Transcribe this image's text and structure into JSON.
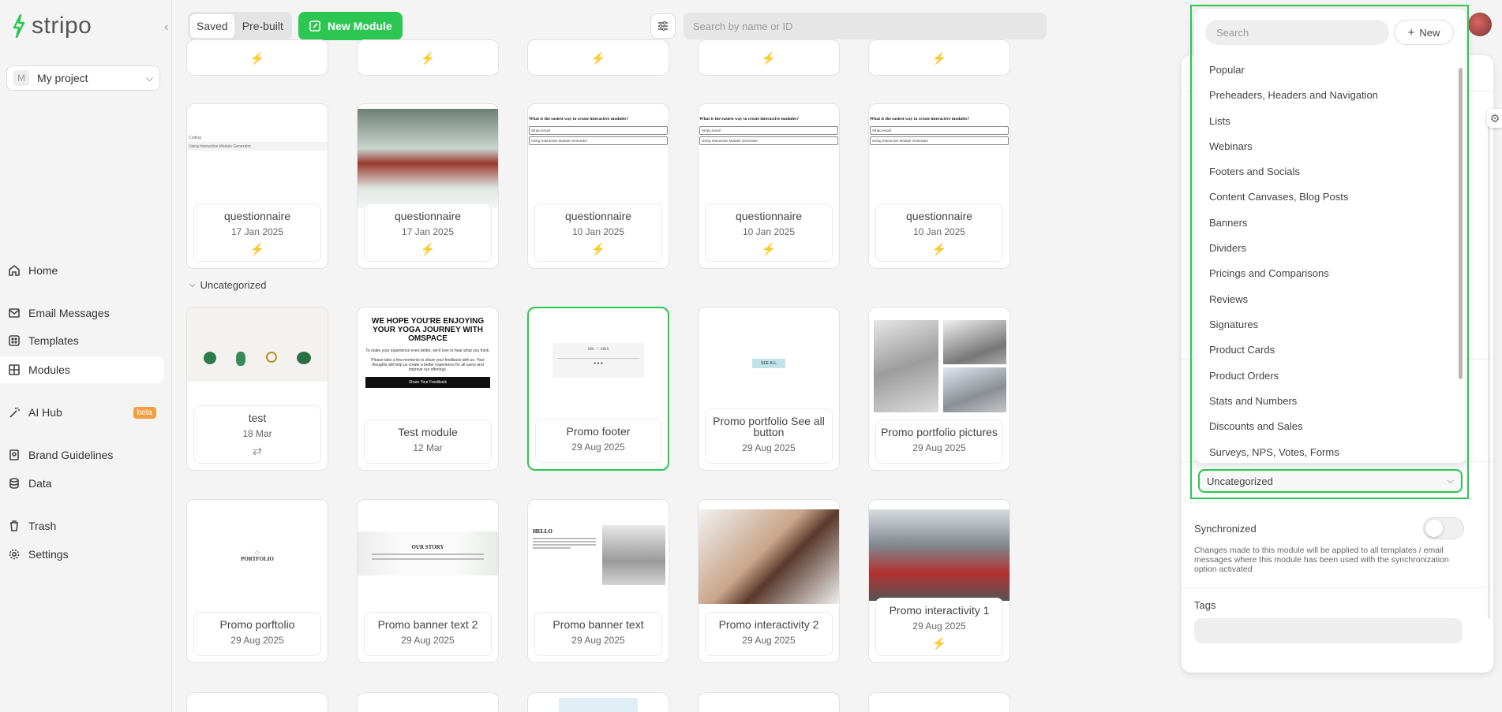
{
  "brand": {
    "name": "stripo",
    "color": "#2dc653"
  },
  "project": {
    "initial": "M",
    "name": "My project"
  },
  "nav": [
    {
      "label": "Home",
      "icon": "home-icon"
    },
    {
      "label": "Email Messages",
      "icon": "mail-icon"
    },
    {
      "label": "Templates",
      "icon": "templates-icon"
    },
    {
      "label": "Modules",
      "icon": "modules-icon",
      "active": true
    },
    {
      "label": "AI Hub",
      "icon": "wand-icon",
      "badge": "beta"
    },
    {
      "label": "Brand Guidelines",
      "icon": "brand-icon"
    },
    {
      "label": "Data",
      "icon": "database-icon"
    },
    {
      "label": "Trash",
      "icon": "trash-icon"
    },
    {
      "label": "Settings",
      "icon": "gear-icon"
    }
  ],
  "toolbar": {
    "tab_saved": "Saved",
    "tab_prebuilt": "Pre-built",
    "new_module": "New Module",
    "search_placeholder": "Search by name or ID"
  },
  "section_title": "Uncategorized",
  "cards_row1": [
    {
      "name": "questionnaire",
      "date": "17 Jan 2025",
      "icon": "bolt-icon"
    },
    {
      "name": "questionnaire",
      "date": "17 Jan 2025",
      "icon": "bolt-icon"
    },
    {
      "name": "questionnaire",
      "date": "10 Jan 2025",
      "icon": "bolt-icon"
    },
    {
      "name": "questionnaire",
      "date": "10 Jan 2025",
      "icon": "bolt-icon"
    },
    {
      "name": "questionnaire",
      "date": "10 Jan 2025",
      "icon": "bolt-icon"
    }
  ],
  "cards_row2": [
    {
      "name": "test",
      "date": "18 Mar",
      "icon": "sync-arrows-icon"
    },
    {
      "name": "Test module",
      "date": "12 Mar"
    },
    {
      "name": "Promo footer",
      "date": "29 Aug 2025"
    },
    {
      "name": "Promo portfolio See all button",
      "date": "29 Aug 2025"
    },
    {
      "name": "Promo portfolio pictures",
      "date": "29 Aug 2025"
    }
  ],
  "cards_row3": [
    {
      "name": "Promo porftolio",
      "date": "29 Aug 2025"
    },
    {
      "name": "Promo banner text 2",
      "date": "29 Aug 2025"
    },
    {
      "name": "Promo banner text",
      "date": "29 Aug 2025"
    },
    {
      "name": "Promo interactivity 2",
      "date": "29 Aug 2025"
    },
    {
      "name": "Promo interactivity 1",
      "date": "29 Aug 2025",
      "icon": "bolt-icon"
    }
  ],
  "thumb_text": {
    "question": "What is the easiest way to create interactive modules?",
    "opt1": "Stripo.email",
    "opt2": "Using Interactive Module Generator",
    "yoga_title": "WE HOPE YOU'RE ENJOYING YOUR YOGA JOURNEY WITH OMSPACE",
    "yoga_body": "To make your experience even better, we'd love to hear what you think.",
    "yoga_body2": "Please take a few moments to share your feedback with us. Your thoughts will help us create a better experience for all users and improve our offerings.",
    "yoga_cta": "Share Your Feedback",
    "see_all": "SEE ALL",
    "footer_logo": "MR. ♡ MRS",
    "portfolio": "PORTFOLIO",
    "our_story": "OUR STORY",
    "hello": "HELLO",
    "coding": "Coding",
    "using_interactive": "Using Interactive Module Generator"
  },
  "dropdown": {
    "search_placeholder": "Search",
    "new_label": "New",
    "items": [
      "Popular",
      "Preheaders, Headers and Navigation",
      "Lists",
      "Webinars",
      "Footers and Socials",
      "Content Canvases, Blog Posts",
      "Banners",
      "Dividers",
      "Pricings and Comparisons",
      "Reviews",
      "Signatures",
      "Product Cards",
      "Product Orders",
      "Stats and Numbers",
      "Discounts and Sales",
      "Surveys, NPS, Votes, Forms"
    ],
    "selected": "Uncategorized"
  },
  "panel": {
    "sync_label": "Synchronized",
    "sync_note": "Changes made to this module will be applied to all templates / email messages where this module has been used with the synchronization option activated",
    "tags_label": "Tags"
  },
  "colors": {
    "accent": "#2dc653",
    "bolt": "#1e63e0",
    "beta": "#f0a040"
  }
}
